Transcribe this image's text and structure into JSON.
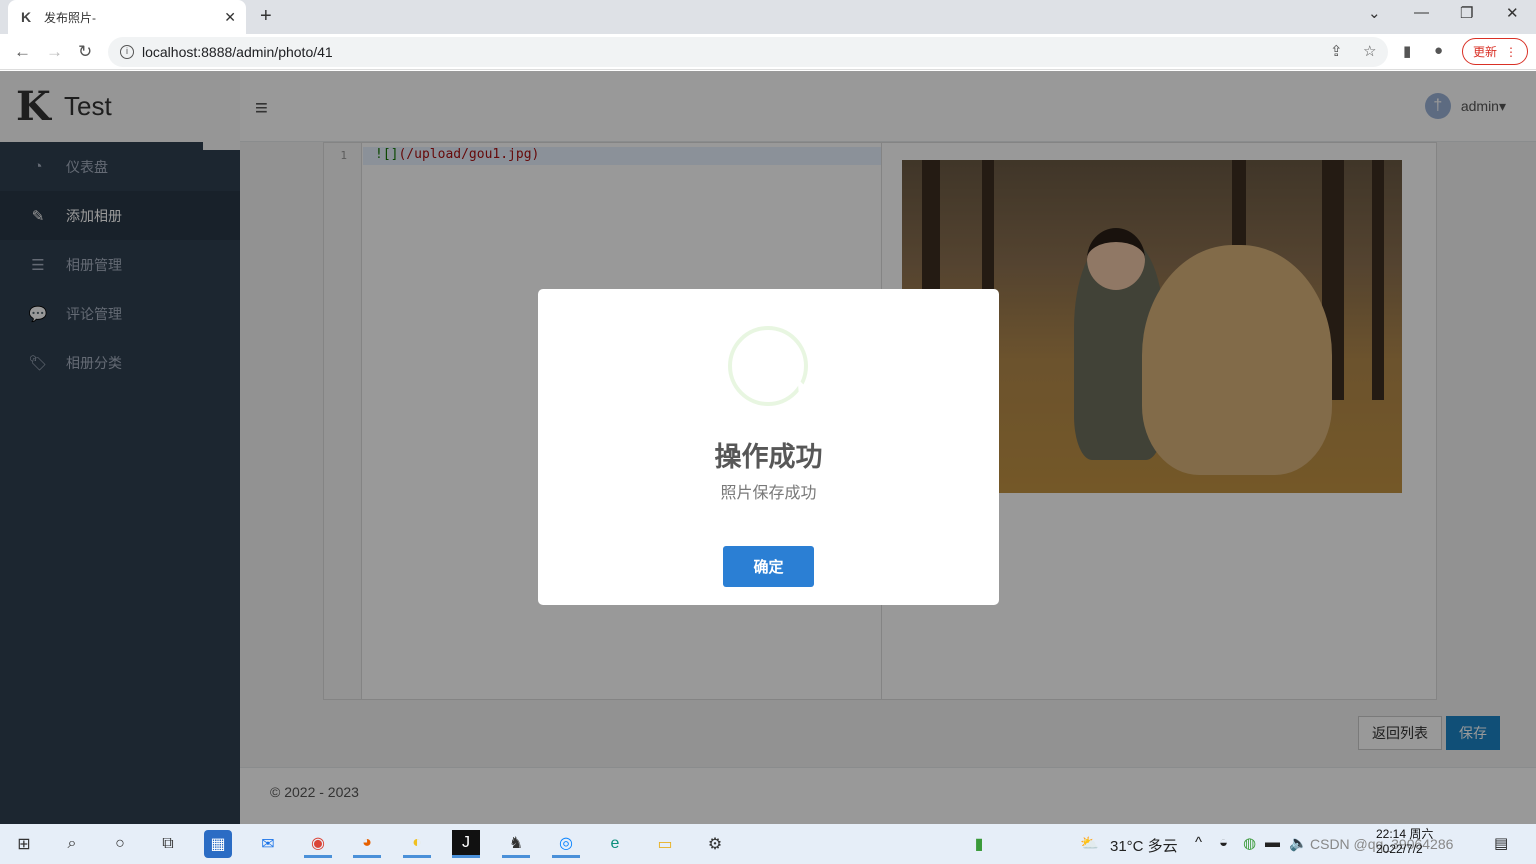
{
  "browser": {
    "tab_title": "发布照片-",
    "url": "localhost:8888/admin/photo/41",
    "update_label": "更新",
    "accent_update": "#d93025"
  },
  "app": {
    "logo_text": "Test",
    "user_name": "admin",
    "menu": [
      {
        "label": "仪表盘",
        "icon": "dashboard-icon"
      },
      {
        "label": "添加相册",
        "icon": "edit-icon",
        "active": true
      },
      {
        "label": "相册管理",
        "icon": "list-icon"
      },
      {
        "label": "评论管理",
        "icon": "comment-icon"
      },
      {
        "label": "相册分类",
        "icon": "tags-icon"
      }
    ],
    "editor": {
      "line_number": "1",
      "code_prefix": "![]",
      "code_path": "(/upload/gou1.jpg)"
    },
    "buttons": {
      "back": "返回列表",
      "save": "保存"
    },
    "footer": "© 2022 - 2023",
    "colors": {
      "sidebar": "#2f4050",
      "primary": "#1c84c6"
    }
  },
  "modal": {
    "title": "操作成功",
    "text": "照片保存成功",
    "confirm": "确定",
    "confirm_color": "#2b7fd4"
  },
  "taskbar": {
    "weather": "31°C  多云",
    "time": "22:14 周六",
    "date": "2022/7/2",
    "watermark": "CSDN @qq_39064286 "
  }
}
